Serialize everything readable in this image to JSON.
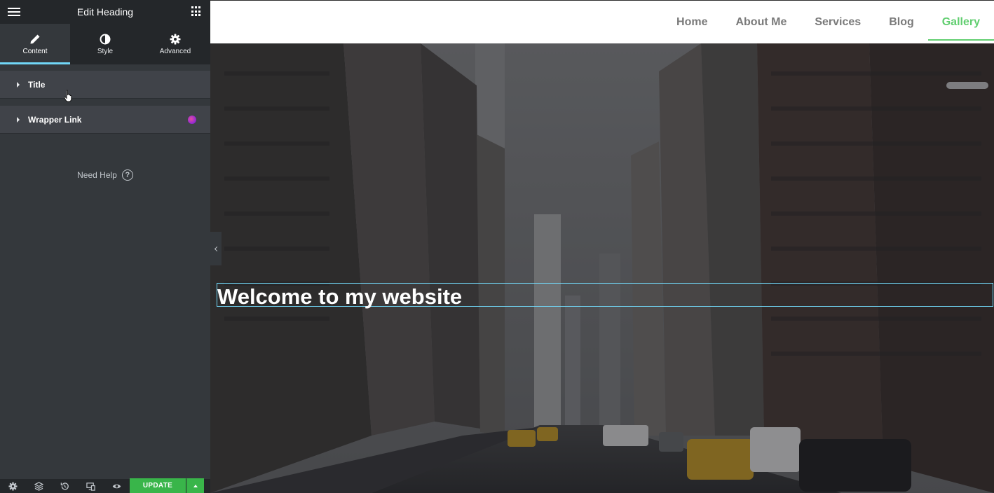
{
  "panel": {
    "title": "Edit Heading",
    "tabs": [
      {
        "label": "Content",
        "icon": "pencil-icon"
      },
      {
        "label": "Style",
        "icon": "contrast-icon"
      },
      {
        "label": "Advanced",
        "icon": "gear-icon"
      }
    ],
    "sections": [
      {
        "label": "Title"
      },
      {
        "label": "Wrapper Link",
        "badge": "pro-badge-icon"
      }
    ],
    "need_help": "Need Help",
    "help_icon_glyph": "?",
    "footer": {
      "icons": [
        "settings-icon",
        "layers-icon",
        "history-icon",
        "responsive-icon",
        "eye-icon"
      ],
      "update_label": "UPDATE"
    }
  },
  "site": {
    "nav": [
      {
        "label": "Home"
      },
      {
        "label": "About Me"
      },
      {
        "label": "Services"
      },
      {
        "label": "Blog"
      },
      {
        "label": "Gallery"
      }
    ],
    "active_nav": "Gallery",
    "hero_heading": "Welcome to my website"
  },
  "colors": {
    "panel_bg": "#34383c",
    "panel_dark": "#24272a",
    "accent_blue": "#71d7f7",
    "update_green": "#39b54a",
    "nav_active": "#61ce70",
    "nav_text": "#7a7a7a"
  }
}
